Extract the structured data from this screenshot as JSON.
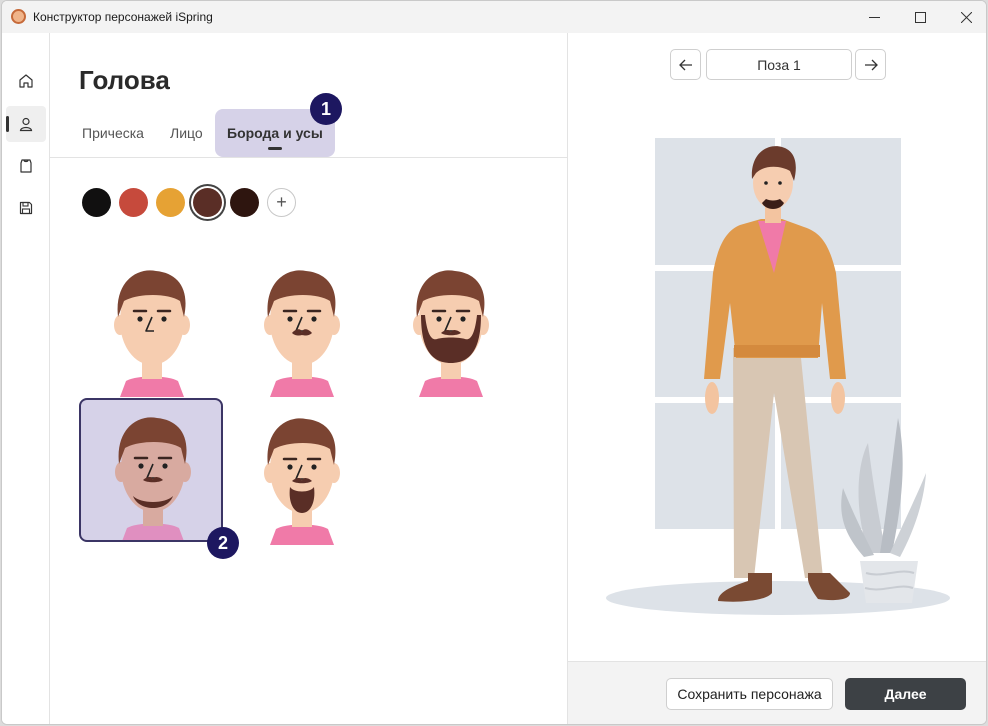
{
  "window": {
    "title": "Конструктор персонажей iSpring"
  },
  "nav": [
    {
      "icon": "home-icon"
    },
    {
      "icon": "person-icon",
      "active": true
    },
    {
      "icon": "shirt-icon"
    },
    {
      "icon": "save-disk-icon"
    }
  ],
  "section": {
    "title": "Голова"
  },
  "tabs": [
    {
      "label": "Прическа"
    },
    {
      "label": "Лицо"
    },
    {
      "label": "Борода и усы",
      "active": true
    }
  ],
  "markers": {
    "tab_marker": "1",
    "card_marker": "2"
  },
  "colors": {
    "swatches": [
      "#111010",
      "#c64a3c",
      "#e6a234",
      "#5a2e26",
      "#2e150f"
    ],
    "selected_swatch_index": 3,
    "accent": "#1d1760",
    "selected_card_bg": "#d6d2e8"
  },
  "beard_options": [
    {
      "style": "none"
    },
    {
      "style": "mustache"
    },
    {
      "style": "full-beard"
    },
    {
      "style": "goatee",
      "selected": true
    },
    {
      "style": "van-dyke"
    }
  ],
  "preview": {
    "pose_label": "Поза 1"
  },
  "footer": {
    "save_label": "Сохранить персонажа",
    "next_label": "Далее"
  }
}
